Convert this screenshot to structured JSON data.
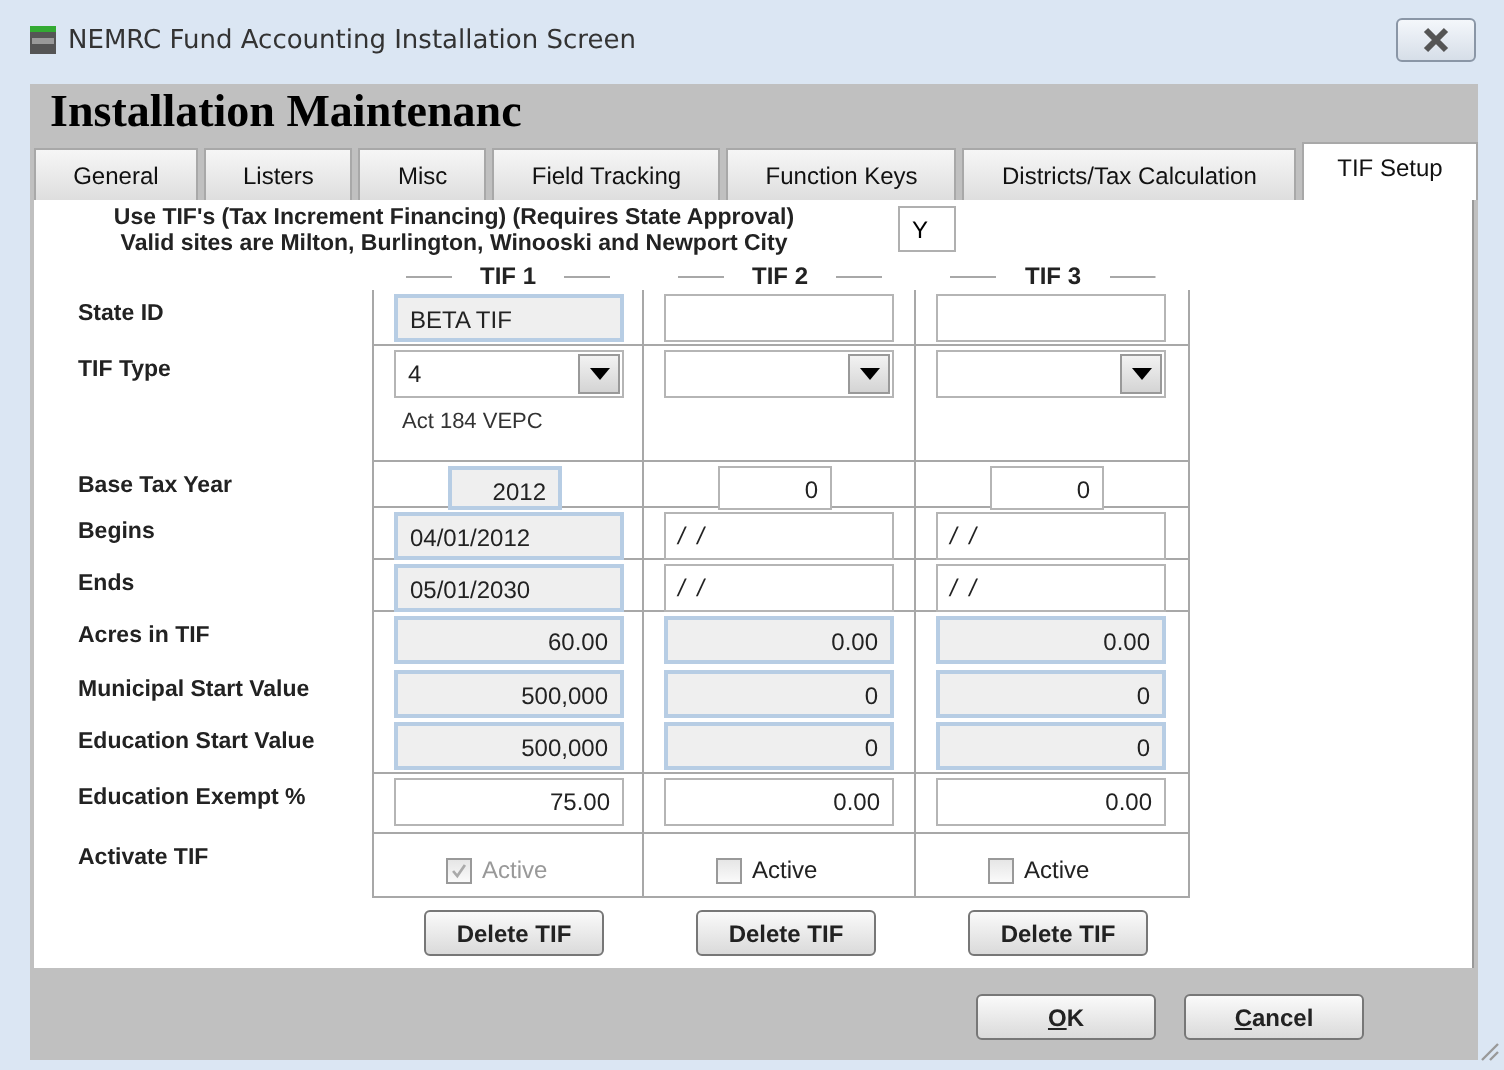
{
  "window": {
    "title": "NEMRC Fund Accounting Installation Screen"
  },
  "heading": "Installation Maintenanc",
  "tabs": [
    {
      "label": "General",
      "selected": false
    },
    {
      "label": "Listers",
      "selected": false
    },
    {
      "label": "Misc",
      "selected": false
    },
    {
      "label": "Field Tracking",
      "selected": false
    },
    {
      "label": "Function Keys",
      "selected": false
    },
    {
      "label": "Districts/Tax Calculation",
      "selected": false
    },
    {
      "label": "TIF Setup",
      "selected": true
    }
  ],
  "intro": {
    "lines": [
      "Use TIF's (Tax Increment Financing) (Requires State Approval)",
      "Valid sites are Milton, Burlington, Winooski and Newport City"
    ],
    "use_tif": "Y"
  },
  "labels": {
    "state_id": "State ID",
    "tif_type": "TIF Type",
    "base_tax_year": "Base Tax Year",
    "begins": "Begins",
    "ends": "Ends",
    "acres": "Acres in TIF",
    "municipal_start": "Municipal Start Value",
    "education_start": "Education Start Value",
    "education_exempt": "Education Exempt %",
    "activate": "Activate TIF"
  },
  "tifs": [
    {
      "title": "TIF 1",
      "locked": true,
      "state_id": "BETA TIF",
      "tif_type": "4",
      "type_description": "Act 184 VEPC",
      "base_tax_year": "2012",
      "begins": "04/01/2012",
      "ends": "05/01/2030",
      "acres": "60.00",
      "municipal_start": "500,000",
      "education_start": "500,000",
      "education_exempt": "75.00",
      "active": {
        "label": "Active",
        "checked": true,
        "disabled": true
      },
      "delete_button": "Delete TIF"
    },
    {
      "title": "TIF 2",
      "locked": false,
      "base_tax_year": "0",
      "begins": "/ /",
      "ends": "/ /",
      "acres": "0.00",
      "municipal_start": "0",
      "education_start": "0",
      "education_exempt": "0.00",
      "active": {
        "label": "Active",
        "checked": false,
        "disabled": false
      },
      "delete_button": "Delete TIF"
    },
    {
      "title": "TIF 3",
      "locked": false,
      "base_tax_year": "0",
      "begins": "/ /",
      "ends": "/ /",
      "acres": "0.00",
      "municipal_start": "0",
      "education_start": "0",
      "education_exempt": "0.00",
      "active": {
        "label": "Active",
        "checked": false,
        "disabled": false
      },
      "delete_button": "Delete TIF"
    }
  ],
  "buttons": [
    {
      "label": "OK"
    },
    {
      "label": "Cancel"
    }
  ]
}
